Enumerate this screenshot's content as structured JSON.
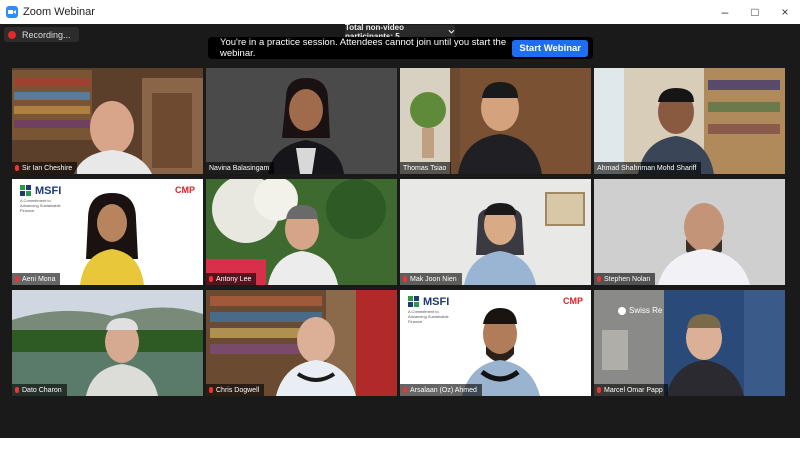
{
  "window": {
    "title": "Zoom Webinar",
    "controls": [
      "–",
      "□",
      "×"
    ]
  },
  "recording": {
    "label": "Recording..."
  },
  "participants_pill": {
    "label": "Total non-video participants: 5"
  },
  "banner": {
    "message": "You're in a practice session. Attendees cannot join until you start the webinar.",
    "button": "Start Webinar"
  },
  "tiles": [
    {
      "name": "Sir Ian Cheshire"
    },
    {
      "name": "Navina Balasingam"
    },
    {
      "name": "Thomas Tsiao"
    },
    {
      "name": "Ahmad Shahriman Mohd Shariff"
    },
    {
      "name": "Aeni Mona"
    },
    {
      "name": "Antony Lee"
    },
    {
      "name": "Mak Joon Nien"
    },
    {
      "name": "Stephen Nolan"
    },
    {
      "name": "Dato Charon"
    },
    {
      "name": "Chris Dogwell"
    },
    {
      "name": "Arsalaan (Oz) Ahmed"
    },
    {
      "name": "Marcel Omar Papp"
    }
  ],
  "logos": {
    "msfi": "MSFI",
    "msfi_sub": "A Commitment to Advancing Sustainable Finance",
    "cmp": "CMP",
    "swiss": "Swiss Re"
  },
  "colors": {
    "start_button": "#1e6df2",
    "recording_dot": "#e02b2b",
    "muted_mic": "#ee3333"
  }
}
